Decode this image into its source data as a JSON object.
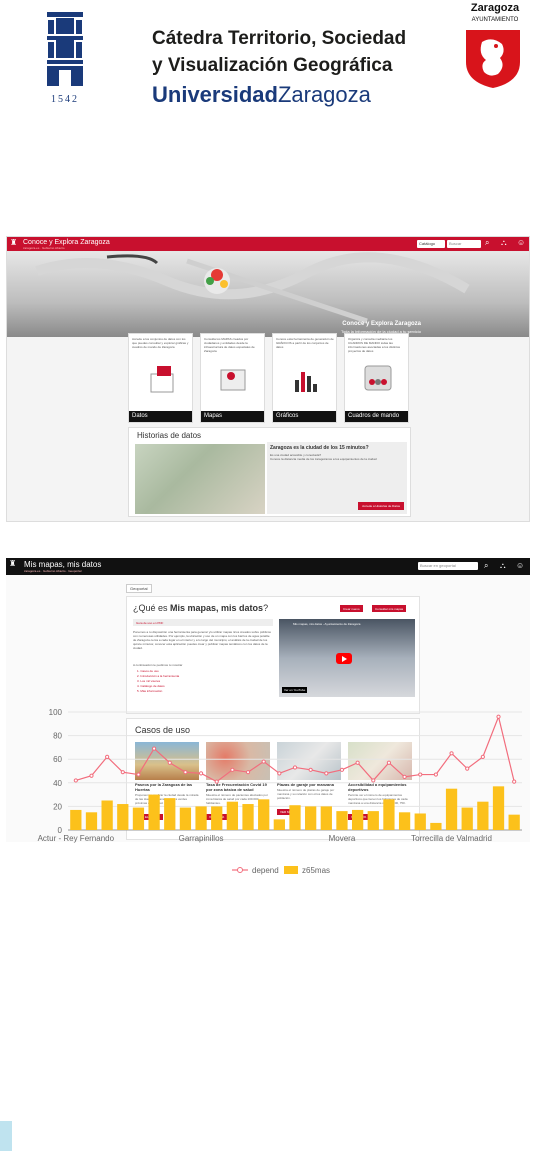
{
  "header": {
    "univ_year": "1542",
    "catedra_line1": "Cátedra Territorio, Sociedad",
    "catedra_line2": "y Visualización Geográfica",
    "univ_bold": "Universidad",
    "univ_regular": "Zaragoza",
    "city_title": "Zaragoza",
    "city_sub": "AYUNTAMIENTO"
  },
  "shot1": {
    "title": "Conoce y Explora Zaragoza",
    "subtitle": "zaragoza.es · Gobierno Abierto",
    "search_scope": "Catálogo",
    "search_placeholder": "Buscar",
    "hero_title": "Conoce y Explora Zaragoza",
    "hero_sub": "Toda la Información de la ciudad a tu servicio",
    "cards": [
      {
        "label": "Datos",
        "text": "Accede a los conjuntos de datos con los que puedes consultar y explorar gráficas y cuadros de mando de Zaragoza"
      },
      {
        "label": "Mapas",
        "text": "Consulta los MAPAS creados por ciudadanos y entidades desde la infraestructura de datos espaciales de Zaragoza"
      },
      {
        "label": "Gráficos",
        "text": "Conoce esta herramienta de generación de GRÁFICOS a partir de los conjuntos de datos"
      },
      {
        "label": "Cuadros de mando",
        "text": "Organiza y consulta mediante los CUADROS DE MANDO todas las informaciones asociadas a los distintos proyectos de datos"
      }
    ],
    "historias_title": "Historias de datos",
    "hist_question": "Zaragoza es la ciudad de los 15 minutos?",
    "hist_desc1": "Es una ciudad accesible y conectada?",
    "hist_desc2": "Conoce la distancia media de los zaragozanos a los equipamientos de la ciudad",
    "hist_button": "Accede a Historias de Datos"
  },
  "shot2": {
    "title": "Mis mapas, mis datos",
    "subtitle": "zaragoza.es · Gobierno Abierto · Geoportal",
    "search_placeholder": "Buscar en geoportal",
    "breadcrumb": "Geoportal",
    "heading_pre": "¿Qué es ",
    "heading_bold": "Mis mapas, mis datos",
    "heading_post": "?",
    "btn1": "Crear nuevo",
    "btn2": "Consultar mis mapas",
    "pdf_link": "Guía de uso en PDF",
    "intro": "Ponemos a tu disposición una herramienta para generar y/o utilizar mapas ricos creados sobre públicos con numerosas utilidades. Por ejemplo, la ubicación y uso de un mapa con los barrios de agua potable de Zaragoza cerca a cada lugar en el interior y a lo largo del municipio; el análisis de la ciudad de los quince minutos; conocer esta aplicación puedes crear y publicar mapas temáticos con los datos de la ciudad.",
    "steps_title": "A continuación te pedimos tu mostrar",
    "steps": [
      "1. Casos de uso",
      "2. Introducción a la herramienta",
      "3. Los mil visores",
      "4. Catálogo de datos",
      "5. Más información"
    ],
    "video_title": "Mis mapas, mis datos - Ayuntamiento de Zaragoza",
    "video_brand": "Ver en YouTube",
    "casos_title": "Casos de uso",
    "cases": [
      {
        "title": "Paseos por la Zaragoza de las Huertas",
        "desc": "Proponemos analizar la ciudad desde la mirada de las Huertas urbanas y zonas verdes próximas a la ciudad.",
        "btn": "VER EL PASEO"
      },
      {
        "title": "Tasa de Frecuentación Covid 19 por zona básica de salud",
        "desc": "Muestra el número de pacientes afectados por zona básica de salud por cada 100.000 habitantes.",
        "btn": "VER MAPA"
      },
      {
        "title": "Plazas de garaje por manzana",
        "desc": "Muestra el número de plazas de garaje por manzana y su relación con otros datos de población.",
        "btn": "VER MAPA"
      },
      {
        "title": "Accesibilidad a equipamientos deportivos",
        "desc": "Permite ver el número de equipamientos deportivos que tienen los habitantes de cada manzana a una distancia de 150, 300, 750.",
        "btn": "VER MAPA"
      }
    ]
  },
  "chart_data": {
    "type": "bar",
    "categories": [
      "Actur - Rey Fernando",
      "",
      "",
      "",
      "",
      "",
      "",
      "",
      "Garrapinillos",
      "",
      "",
      "",
      "",
      "",
      "",
      "",
      "",
      "Movera",
      "",
      "",
      "",
      "",
      "",
      "",
      "Torrecilla de Valmadrid",
      "",
      "",
      "",
      "",
      ""
    ],
    "series": [
      {
        "name": "depend",
        "type": "line",
        "color": "#f26d7d",
        "values": [
          42,
          46,
          62,
          49,
          47,
          69,
          57,
          49,
          48,
          41,
          51,
          49,
          58,
          48,
          53,
          51,
          48,
          51,
          57,
          42,
          57,
          45,
          47,
          47,
          65,
          52,
          62,
          96,
          41
        ]
      },
      {
        "name": "z65mas",
        "type": "bar",
        "color": "#fcc11b",
        "values": [
          17,
          15,
          25,
          22,
          19,
          30,
          27,
          19,
          20,
          20,
          24,
          22,
          26,
          9,
          21,
          20,
          20,
          16,
          17,
          16,
          26,
          15,
          14,
          6,
          35,
          19,
          24,
          37,
          13
        ]
      }
    ],
    "ylim": [
      0,
      100
    ],
    "yticks": [
      0,
      20,
      40,
      60,
      80,
      100
    ],
    "grid": true,
    "legend": "bottom"
  },
  "colors": {
    "accent_red": "#c8102e",
    "univ_blue": "#1a3a7a"
  }
}
